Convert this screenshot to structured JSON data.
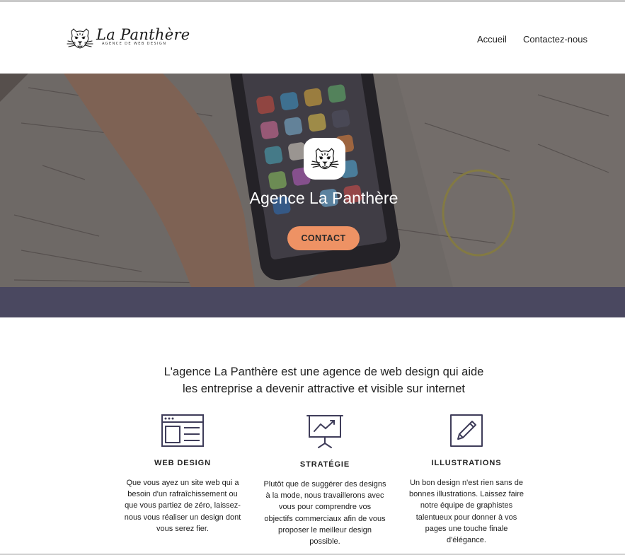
{
  "header": {
    "logo_name": "La Panthère",
    "logo_tagline": "AGENCE DE WEB DESIGN",
    "nav": [
      "Accueil",
      "Contactez-nous"
    ]
  },
  "hero": {
    "title": "Agence La Panthère",
    "button_label": "CONTACT",
    "button_color": "#ee9264",
    "band_color": "#4a4860"
  },
  "intro": {
    "line1": "L'agence La Panthère est une agence de web design qui aide",
    "line2": "les entreprise a devenir attractive et visible sur internet"
  },
  "features": [
    {
      "icon": "browser-window-icon",
      "title": "WEB DESIGN",
      "text": [
        "Que vous ayez un site web qui a",
        "besoin d'un rafraîchissement ou",
        "que vous partiez de zéro, laissez-",
        "nous vous réaliser un design dont",
        "vous serez fier."
      ]
    },
    {
      "icon": "presentation-chart-icon",
      "title": "STRATÉGIE",
      "text": [
        "Plutôt que de suggérer des designs",
        "à la mode, nous travaillerons avec",
        "vous pour comprendre vos",
        "objectifs commerciaux afin de vous",
        "proposer le meilleur design",
        "possible."
      ]
    },
    {
      "icon": "pencil-icon",
      "title": "ILLUSTRATIONS",
      "text": [
        "Un bon design n'est rien sans de",
        "bonnes illustrations. Laissez faire",
        "notre équipe de graphistes",
        "talentueux pour donner à vos",
        "pages une touche finale",
        "d'élégance."
      ]
    }
  ],
  "colors": {
    "icon_stroke": "#3f3d5a",
    "text": "#222222"
  }
}
